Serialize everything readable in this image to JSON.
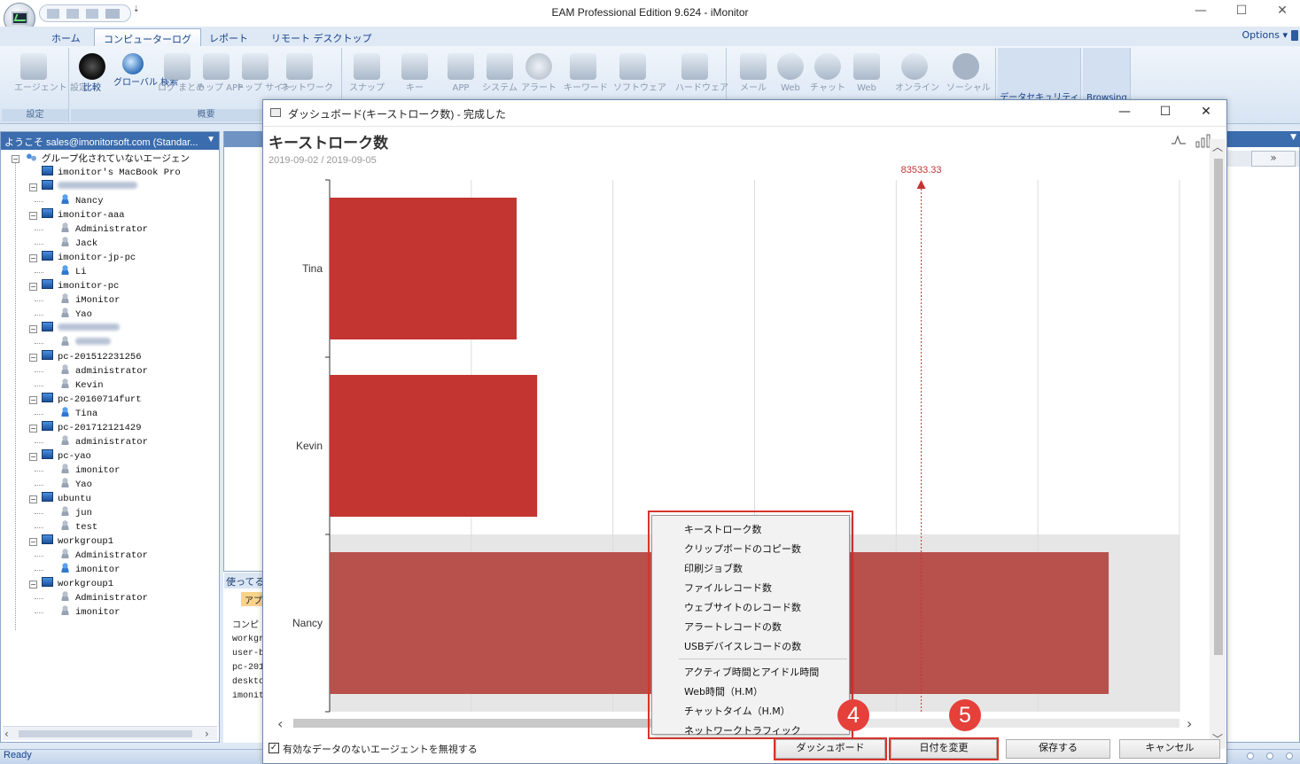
{
  "window": {
    "title": "EAM Professional Edition 9.624 - iMonitor",
    "minimize": "—",
    "maximize": "☐",
    "close": "✕",
    "qat_dropdown": "⇣"
  },
  "tabs": [
    {
      "label": "ホーム"
    },
    {
      "label": "コンピューターログ"
    },
    {
      "label": "レポート"
    },
    {
      "label": "リモート デスクトップ"
    }
  ],
  "options_label": "Options",
  "ribbon": {
    "group1_label": "設定",
    "group2_label": "概要",
    "buttons": {
      "agent": "エージェント 設定",
      "compare": "比較",
      "global_search": "グローバル 検索",
      "log_summary": "ログ まとめ",
      "top_app": "トップ APP",
      "top_site": "トップ サイト",
      "network": "ネットワーク",
      "snapshot": "スナップ",
      "key": "キー",
      "app": "APP",
      "system": "システム",
      "alert": "アラート",
      "keyword": "キーワード",
      "software": "ソフトウェア",
      "hardware": "ハードウェア",
      "mail": "メール",
      "web": "Web",
      "chat": "チャット",
      "web2": "Web",
      "online": "オンライン",
      "social": "ソーシャル",
      "data_security": "データセキュリティ",
      "browsing": "Browsing"
    }
  },
  "left_panel": {
    "header": "ようこそ sales@imonitorsoft.com (Standar...",
    "nodes": [
      "グループ化されていないエージェン",
      "imonitor's MacBook Pro",
      "Nancy",
      "imonitor-aaa",
      "Administrator",
      "Jack",
      "imonitor-jp-pc",
      "Li",
      "imonitor-pc",
      "iMonitor",
      "Yao",
      "pc-201512231256",
      "administrator",
      "Kevin",
      "pc-20160714furt",
      "Tina",
      "pc-201712121429",
      "administrator",
      "pc-yao",
      "imonitor",
      "Yao",
      "ubuntu",
      "jun",
      "test",
      "workgroup1",
      "Administrator",
      "imonitor",
      "workgroup1",
      "Administrator",
      "imonitor"
    ]
  },
  "mid_panel": {
    "tab": "使ってる",
    "subtab": "アプ",
    "lines": [
      "コンピ",
      "workgr",
      "user-b",
      "pc-201",
      "deskto",
      "imonit"
    ]
  },
  "dashboard": {
    "title": "ダッシュボード(キーストローク数) - 完成した",
    "chart_title": "キーストローク数",
    "date_range": "2019-09-02 / 2019-09-05",
    "ignore_label": "有効なデータのないエージェントを無視する",
    "ignore_checked": "✓",
    "buttons": {
      "dashboard": "ダッシュボード",
      "change_date": "日付を変更",
      "save": "保存する",
      "cancel": "キャンセル"
    },
    "badges": [
      "4",
      "5"
    ]
  },
  "chart_data": {
    "type": "bar",
    "orientation": "horizontal",
    "title": "キーストローク数",
    "subtitle": "2019-09-02 / 2019-09-05",
    "categories": [
      "Tina",
      "Kevin",
      "Nancy"
    ],
    "values": [
      26400,
      29300,
      110000
    ],
    "xlim": [
      0,
      120000
    ],
    "reference_line": {
      "value": 83533.33,
      "label": "83533.33"
    },
    "highlighted_category": "Nancy",
    "grid": true,
    "colors": {
      "bar": "#c23531",
      "highlight_bar": "#b8504c",
      "reference": "#c23531"
    }
  },
  "context_menu": {
    "items": [
      "キーストローク数",
      "クリップボードのコピー数",
      "印刷ジョブ数",
      "ファイルレコード数",
      "ウェブサイトのレコード数",
      "アラートレコードの数",
      "USBデバイスレコードの数",
      "アクティブ時間とアイドル時間",
      "Web時間（H.M）",
      "チャットタイム（H.M）",
      "ネットワークトラフィック"
    ]
  },
  "status": {
    "text": "Ready"
  },
  "right_panel": {
    "next": "»"
  },
  "colors": {
    "accent": "#15428b",
    "highlight_red": "#d9342b",
    "panel_header": "#3b6dae"
  }
}
